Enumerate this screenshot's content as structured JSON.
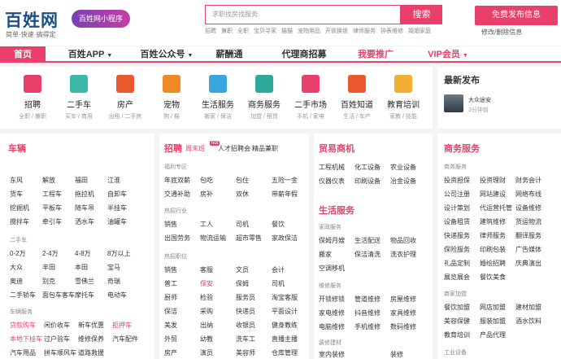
{
  "header": {
    "logo": "百姓网",
    "slogan": "简单·快速·搞得定",
    "mini_program": "百姓网小程序",
    "search_placeholder": "求职找房找服务",
    "search_button": "搜索",
    "hot_searches": [
      "招聘",
      "兼职",
      "全职",
      "宝贝寻家",
      "猫猫",
      "宠物用品",
      "开锁换锁",
      "律师服务",
      "钟表维修",
      "婚姻家庭"
    ],
    "publish_button": "免费发布信息",
    "manage_link": "修改/删除信息"
  },
  "nav": [
    "首页",
    "百姓APP",
    "百姓公众号",
    "薪酬通",
    "代理商招募",
    "我要推广",
    "VIP会员"
  ],
  "categories": [
    {
      "name": "招聘",
      "sub": "全职 / 兼职",
      "color": "#e8406b"
    },
    {
      "name": "二手车",
      "sub": "买车 / 商用",
      "color": "#3bb8a8"
    },
    {
      "name": "房产",
      "sub": "出租 / 二手房",
      "color": "#e85a2e"
    },
    {
      "name": "宠物",
      "sub": "狗 / 猫",
      "color": "#f08a24"
    },
    {
      "name": "生活服务",
      "sub": "搬家 / 保洁",
      "color": "#3aa4e0"
    },
    {
      "name": "商务服务",
      "sub": "加盟 / 租赁",
      "color": "#2eaa9c"
    },
    {
      "name": "二手市场",
      "sub": "手机 / 家电",
      "color": "#e8406b"
    },
    {
      "name": "百姓知道",
      "sub": "生活 / 车产",
      "color": "#e85a2e"
    },
    {
      "name": "教育培训",
      "sub": "家教 / 技能",
      "color": "#f2b033"
    }
  ],
  "news": {
    "title": "最新发布",
    "item": "大众途安",
    "time": "3分钟前"
  },
  "car": {
    "title": "车辆",
    "rows1": [
      [
        "东风",
        "解放",
        "福田",
        "江淮"
      ],
      [
        "货车",
        "工程车",
        "拖拉机",
        "自卸车"
      ],
      [
        "挖掘机",
        "平板车",
        "随车吊",
        "半挂车"
      ],
      [
        "搅拌车",
        "牵引车",
        "洒水车",
        "油罐车"
      ]
    ],
    "sec2": "二手车",
    "rows2": [
      [
        "0-2万",
        "2-4万",
        "4-8万",
        "8万以上"
      ],
      [
        "大众",
        "丰田",
        "本田",
        "宝马"
      ],
      [
        "奥迪",
        "别克",
        "雪佛兰",
        "奇瑞"
      ],
      [
        "二手轿车",
        "面包车客车",
        "摩托车",
        "电动车"
      ]
    ],
    "sec3": "车辆服务",
    "rows3": [
      [
        "贷款购车",
        "闲价收车",
        "新车优惠",
        "拒押车"
      ],
      [
        "本地下挂车",
        "过户验车",
        "维修保养",
        "汽车配件"
      ],
      [
        "汽车用品",
        "拼车顺风车",
        "道路救援",
        ""
      ]
    ]
  },
  "jobs": {
    "title": "招聘",
    "tab1": "周末班",
    "tab_badge": "hot",
    "tab2": "人才招聘会",
    "tab3": "精品兼职",
    "sec1": "福利专区",
    "rows1": [
      [
        "年底双薪",
        "包吃",
        "包住",
        "五险一金"
      ],
      [
        "交通补助",
        "房补",
        "双休",
        "带薪年假"
      ]
    ],
    "sec2": "热招行业",
    "rows2": [
      [
        "销售",
        "工人",
        "司机",
        "餐饮"
      ],
      [
        "出国劳务",
        "物流运输",
        "超市零售",
        "家政保洁"
      ]
    ],
    "sec3": "热招职位",
    "rows3": [
      [
        "销售",
        "客服",
        "文员",
        "会计"
      ],
      [
        "普工",
        "保安",
        "保姆",
        "司机"
      ],
      [
        "厨师",
        "检验",
        "服务员",
        "淘宝客服"
      ],
      [
        "保洁",
        "采购",
        "快递员",
        "平面设计"
      ],
      [
        "美发",
        "出纳",
        "收银员",
        "健身教练"
      ],
      [
        "外贸",
        "幼教",
        "洗车工",
        "直播主播"
      ],
      [
        "房产",
        "演员",
        "美容师",
        "仓库管理"
      ]
    ]
  },
  "trade": {
    "title": "贸易商机",
    "rows": [
      [
        "工程机械",
        "化工设备",
        "农业设备"
      ],
      [
        "仪器仪表",
        "印刷设备",
        "冶金设备"
      ]
    ]
  },
  "life": {
    "title": "生活服务",
    "sec1": "家政服务",
    "rows1": [
      [
        "保姆月嫂",
        "生活配送",
        "物品回收"
      ],
      [
        "搬家",
        "保洁清洗",
        "洗衣护理"
      ],
      [
        "空调移机",
        "",
        ""
      ]
    ],
    "sec2": "维修服务",
    "rows2": [
      [
        "开锁修锁",
        "管道维修",
        "房屋维修"
      ],
      [
        "家电维修",
        "抖音维修",
        "家具维修"
      ],
      [
        "电脑维修",
        "手机维修",
        "数码维修"
      ]
    ],
    "sec3": "装修建材",
    "rows3": [
      [
        "室内装修",
        "",
        "装修"
      ]
    ]
  },
  "biz": {
    "title": "商务服务",
    "sec1": "商务服务",
    "rows1": [
      [
        "投资担保",
        "投资理财",
        "财务会计"
      ],
      [
        "公司注册",
        "网站建设",
        "网络布线"
      ],
      [
        "设计策划",
        "代运营托管",
        "设备维修"
      ],
      [
        "设备租赁",
        "建筑维修",
        "货运物流"
      ],
      [
        "快递服务",
        "律师服务",
        "翻译服务"
      ],
      [
        "保险服务",
        "印刷包装",
        "广告媒体"
      ],
      [
        "礼品定制",
        "婚绘招聘",
        "庆典演出"
      ],
      [
        "展览展会",
        "餐饮美食",
        ""
      ]
    ],
    "sec2": "商家加盟",
    "rows2": [
      [
        "餐饮加盟",
        "网店加盟",
        "建材加盟"
      ],
      [
        "美容保健",
        "服装加盟",
        "酒水饮料"
      ],
      [
        "教育培训",
        "产品代理",
        ""
      ]
    ],
    "sec3": "工业设备"
  }
}
